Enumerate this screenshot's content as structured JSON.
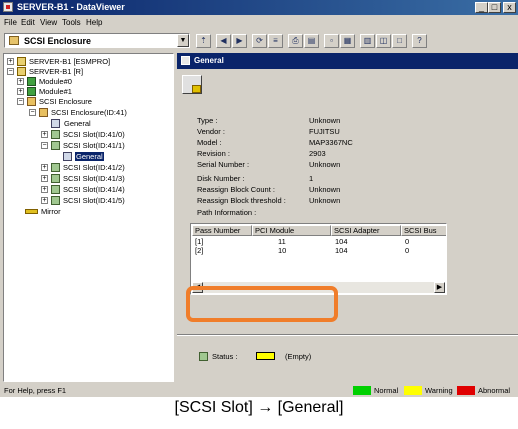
{
  "window": {
    "title": "SERVER-B1 - DataViewer",
    "minimize": "_",
    "maximize": "□",
    "close": "x"
  },
  "menu": [
    "File",
    "Edit",
    "View",
    "Tools",
    "Help"
  ],
  "toolbar": {
    "combo_value": "SCSI Enclosure",
    "combo_icon": "enclosure-icon"
  },
  "tree": {
    "nodes": [
      {
        "label": "SERVER-B1 [ESMPRO]",
        "icon": "server-icon",
        "expander": "+"
      },
      {
        "label": "SERVER-B1 [R]",
        "icon": "server-icon",
        "expander": "−"
      },
      {
        "label": "Module#0",
        "icon": "module-icon",
        "expander": "+"
      },
      {
        "label": "Module#1",
        "icon": "module-icon",
        "expander": "+"
      },
      {
        "label": "SCSI Enclosure",
        "icon": "enclosure-icon",
        "expander": "−"
      },
      {
        "label": "SCSI Enclosure(ID:41)",
        "icon": "enclosure-icon",
        "expander": "−"
      },
      {
        "label": "General",
        "icon": "general-icon",
        "expander": ""
      },
      {
        "label": "SCSI Slot(ID:41/0)",
        "icon": "slot-icon",
        "expander": "+"
      },
      {
        "label": "SCSI Slot(ID:41/1)",
        "icon": "slot-icon",
        "expander": "−"
      },
      {
        "label": "General",
        "icon": "general-icon",
        "expander": "",
        "selected": true
      },
      {
        "label": "SCSI Slot(ID:41/2)",
        "icon": "slot-icon",
        "expander": "+"
      },
      {
        "label": "SCSI Slot(ID:41/3)",
        "icon": "slot-icon",
        "expander": "+"
      },
      {
        "label": "SCSI Slot(ID:41/4)",
        "icon": "slot-icon",
        "expander": "+"
      },
      {
        "label": "SCSI Slot(ID:41/5)",
        "icon": "slot-icon",
        "expander": "+"
      },
      {
        "label": "Mirror",
        "icon": "mirror-icon",
        "expander": ""
      }
    ]
  },
  "panel": {
    "header": "General",
    "properties": [
      {
        "label": "Type :",
        "value": "Unknown"
      },
      {
        "label": "Vendor :",
        "value": "FUJITSU"
      },
      {
        "label": "Model :",
        "value": "MAP3367NC"
      },
      {
        "label": "Revision :",
        "value": "2903"
      },
      {
        "label": "Serial Number :",
        "value": "Unknown"
      },
      {
        "label": "Disk Number :",
        "value": "1"
      },
      {
        "label": "Reassign Block Count :",
        "value": "Unknown"
      },
      {
        "label": "Reassign Block threshold :",
        "value": "Unknown"
      },
      {
        "label": "Path Information :",
        "value": ""
      }
    ],
    "path_table": {
      "columns": [
        "Pass Number",
        "PCI Module",
        "SCSI Adapter",
        "SCSI Bus"
      ],
      "rows": [
        [
          "[1]",
          "11",
          "104",
          "0"
        ],
        [
          "[2]",
          "10",
          "104",
          "0"
        ]
      ]
    },
    "status": {
      "label": "Status :",
      "value": "(Empty)",
      "color": "#ffff00"
    }
  },
  "statusbar": {
    "help_text": "For Help, press F1",
    "legend": [
      {
        "label": "Normal",
        "color": "#00d000"
      },
      {
        "label": "Warning",
        "color": "#ffff00"
      },
      {
        "label": "Abnormal",
        "color": "#e00000"
      }
    ]
  },
  "caption": "[SCSI Slot] → [General]"
}
